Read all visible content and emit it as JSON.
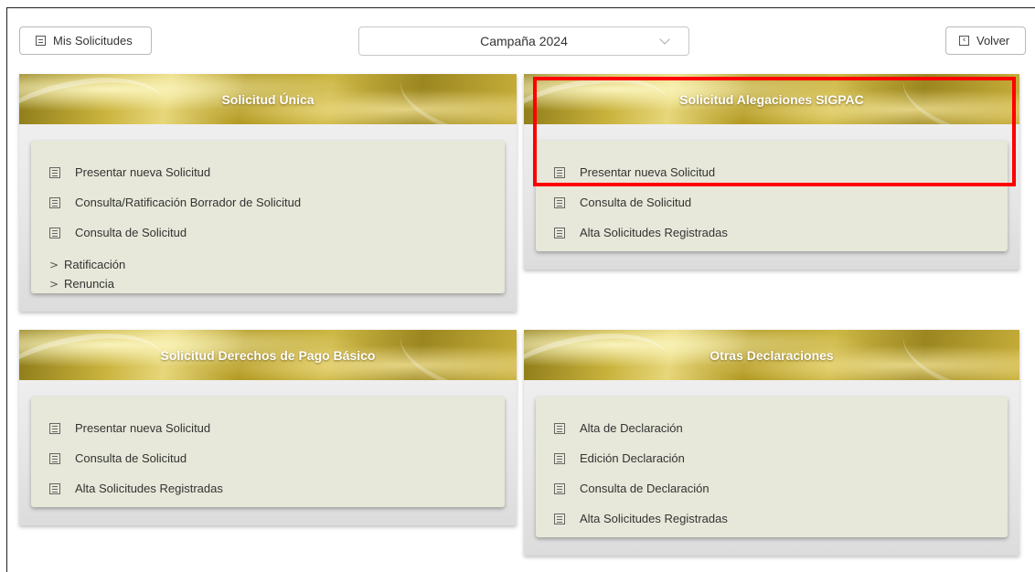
{
  "toolbar": {
    "my_requests_label": "Mis Solicitudes",
    "campaign_selected": "Campaña 2024",
    "back_label": "Volver"
  },
  "cards": {
    "solicitud_unica": {
      "title": "Solicitud Única",
      "items": [
        "Presentar nueva Solicitud",
        "Consulta/Ratificación Borrador de Solicitud",
        "Consulta de Solicitud"
      ],
      "expandables": [
        "Ratificación",
        "Renuncia"
      ]
    },
    "alegaciones": {
      "title": "Solicitud Alegaciones SIGPAC",
      "items": [
        "Presentar nueva Solicitud",
        "Consulta de Solicitud",
        "Alta Solicitudes Registradas"
      ]
    },
    "derechos": {
      "title": "Solicitud Derechos de Pago Básico",
      "items": [
        "Presentar nueva Solicitud",
        "Consulta de Solicitud",
        "Alta Solicitudes Registradas"
      ]
    },
    "otras": {
      "title": "Otras Declaraciones",
      "items": [
        "Alta de Declaración",
        "Edición Declaración",
        "Consulta de Declaración",
        "Alta Solicitudes Registradas"
      ]
    }
  },
  "icons": {
    "list": "list-icon",
    "chevron": "chevron-down-icon",
    "back": "back-icon",
    "expand": "chevron-right-icon"
  },
  "colors": {
    "banner_gold": "#c9b23c",
    "inner_panel": "#e7e8d9",
    "highlight": "#ff0000"
  }
}
